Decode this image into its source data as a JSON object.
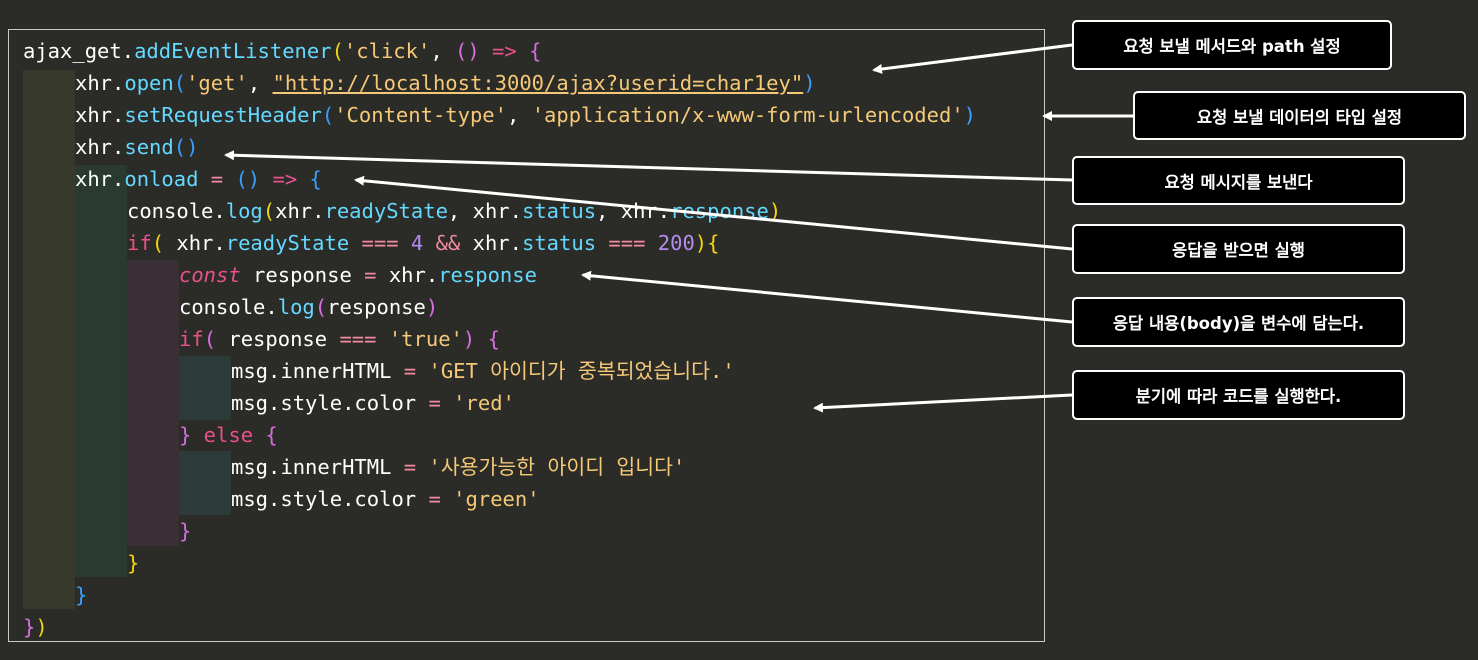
{
  "code": {
    "l1": {
      "a": "ajax_get",
      "b": ".",
      "c": "addEventListener",
      "d": "(",
      "e": "'click'",
      "f": ", ",
      "g": "()",
      "h": " => ",
      "i": "{"
    },
    "l2": {
      "a": "xhr",
      "b": ".",
      "c": "open",
      "d": "(",
      "e": "'get'",
      "f": ", ",
      "g": "\"http://localhost:3000/ajax?userid=char1ey\"",
      "h": ")"
    },
    "l3": {
      "a": "xhr",
      "b": ".",
      "c": "setRequestHeader",
      "d": "(",
      "e": "'Content-type'",
      "f": ", ",
      "g": "'application/x-www-form-urlencoded'",
      "h": ")"
    },
    "l4": {
      "a": "xhr",
      "b": ".",
      "c": "send",
      "d": "()"
    },
    "l5": {
      "a": "xhr",
      "b": ".",
      "c": "onload",
      "d": " = ",
      "e": "()",
      "f": " => ",
      "g": "{"
    },
    "l6": {
      "a": "console",
      "b": ".",
      "c": "log",
      "d": "(",
      "e": "xhr",
      "f": ".",
      "g": "readyState",
      "h": ", ",
      "i": "xhr",
      "j": ".",
      "k": "status",
      "l": ", ",
      "m": "xhr",
      "n": ".",
      "o": "response",
      "p": ")"
    },
    "l7": {
      "a": "if",
      "b": "( ",
      "c": "xhr",
      "d": ".",
      "e": "readyState",
      "f": " === ",
      "g": "4",
      "h": " && ",
      "i": "xhr",
      "j": ".",
      "k": "status",
      "l": " === ",
      "m": "200",
      "n": ")",
      "o": "{"
    },
    "l8": {
      "a": "const",
      "b": " response ",
      "c": "=",
      "d": " xhr",
      "e": ".",
      "f": "response"
    },
    "l9": {
      "a": "console",
      "b": ".",
      "c": "log",
      "d": "(",
      "e": "response",
      "f": ")"
    },
    "l10": {
      "a": "if",
      "b": "( ",
      "c": "response ",
      "d": "===",
      "e": " ",
      "f": "'true'",
      "g": ")",
      "h": " {"
    },
    "l11": {
      "a": "msg.innerHTML ",
      "b": "=",
      "c": " ",
      "d": "'GET 아이디가 중복되었습니다.'"
    },
    "l12": {
      "a": "msg.style.color ",
      "b": "=",
      "c": " ",
      "d": "'red'"
    },
    "l13": {
      "a": "}",
      "b": " else ",
      "c": "{"
    },
    "l14": {
      "a": "msg.innerHTML ",
      "b": "=",
      "c": " ",
      "d": "'사용가능한 아이디 입니다'"
    },
    "l15": {
      "a": "msg.style.color ",
      "b": "=",
      "c": " ",
      "d": "'green'"
    },
    "l16": {
      "a": "}"
    },
    "l17": {
      "a": "}"
    },
    "l18": {
      "a": "}"
    },
    "l19": {
      "a": "}",
      "b": ")"
    }
  },
  "callouts": {
    "c1": "요청 보낼 메서드와 path 설정",
    "c2": "요청 보낼 데이터의 타입 설정",
    "c3": "요청 메시지를 보낸다",
    "c4": "응답을 받으면 실행",
    "c5": "응답 내용(body)을 변수에 담는다.",
    "c6": "분기에 따라 코드를 실행한다."
  },
  "colors": {
    "background": "#2b2b28",
    "keyword": "#e9508c",
    "function": "#64d9ff",
    "string": "#f5c978",
    "number": "#b48cf0",
    "bracket_gold": "#f1d70f",
    "bracket_purple": "#d86ee0",
    "bracket_blue": "#3aa0ff"
  }
}
